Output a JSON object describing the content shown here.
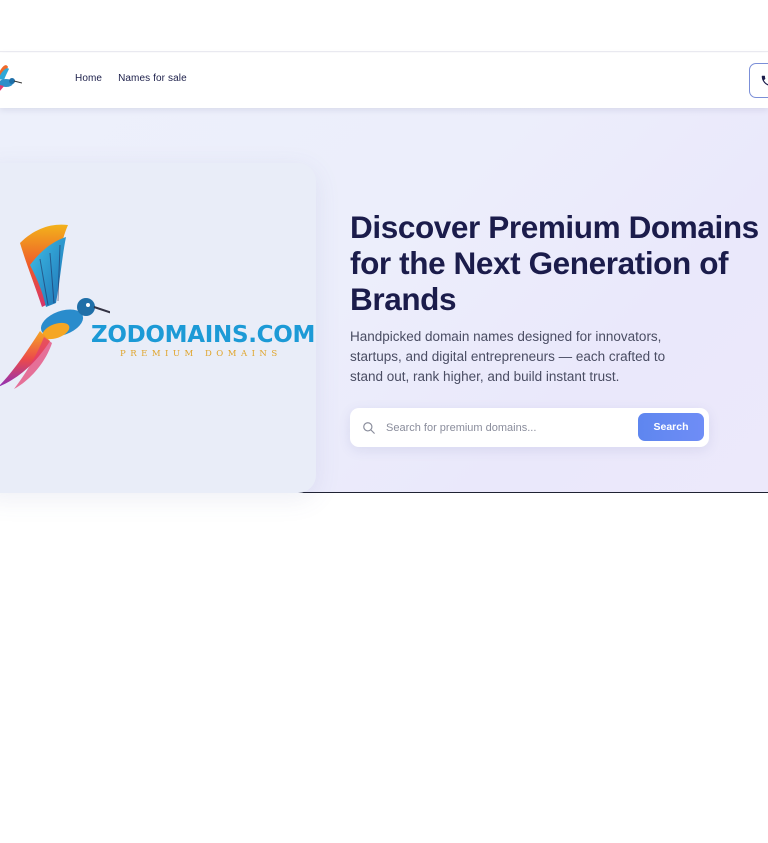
{
  "nav": {
    "links": [
      {
        "label": "Home"
      },
      {
        "label": "Names for sale"
      }
    ],
    "contact_icon": "phone-icon"
  },
  "brand": {
    "name": "ZODOMAINS.COM",
    "tagline": "PREMIUM DOMAINS",
    "logo_icon": "hummingbird-icon",
    "colors": {
      "name": "#1c9ad6",
      "tagline": "#e0a52c"
    }
  },
  "hero": {
    "title": "Discover Premium Domains for the Next Generation of Brands",
    "description": "Handpicked domain names designed for innovators, startups, and digital entrepreneurs — each crafted to stand out, rank higher, and build instant trust."
  },
  "search": {
    "placeholder": "Search for premium domains...",
    "value": "",
    "button_label": "Search",
    "icon": "search-icon"
  },
  "colors": {
    "heading": "#1b1c4b",
    "accent": "#6f8df6",
    "hero_bg": "#eceefb"
  }
}
